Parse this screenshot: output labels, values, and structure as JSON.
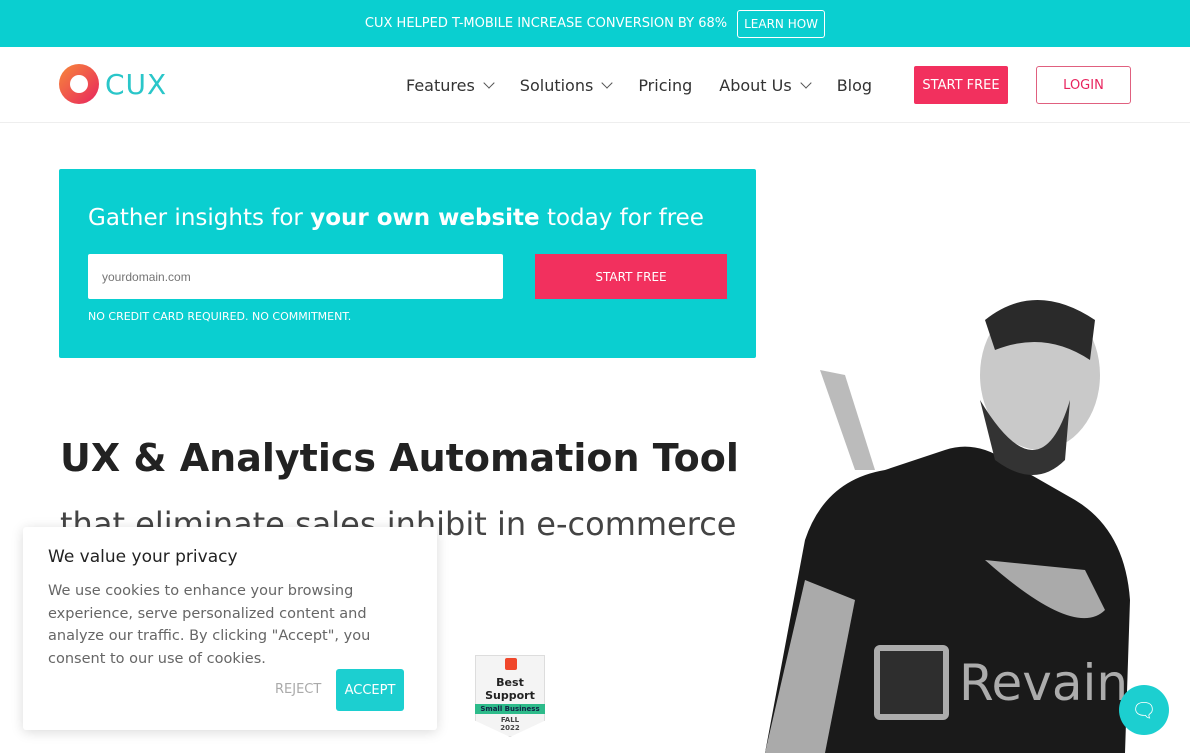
{
  "announcement": {
    "text": "CUX HELPED T-MOBILE INCREASE CONVERSION BY 68%",
    "button": "LEARN HOW"
  },
  "nav": {
    "logo": "CUX",
    "items": [
      {
        "label": "Features",
        "dropdown": true
      },
      {
        "label": "Solutions",
        "dropdown": true
      },
      {
        "label": "Pricing"
      },
      {
        "label": "About Us",
        "dropdown": true
      },
      {
        "label": "Blog"
      }
    ],
    "start_free": "START FREE",
    "login": "LOGIN"
  },
  "hero": {
    "title_pre": "Gather insights for ",
    "title_bold": "your own website",
    "title_post": " today for free",
    "input_placeholder": "yourdomain.com",
    "button": "START FREE",
    "note": "NO CREDIT CARD REQUIRED. NO COMMITMENT."
  },
  "headline": "UX & Analytics Automation Tool",
  "subheadline": "that eliminate sales inhibit in e-commerce",
  "badge": {
    "title": "Best Support",
    "ribbon": "Small Business",
    "season": "FALL",
    "year": "2022"
  },
  "cookie": {
    "title": "We value your privacy",
    "body": "We use cookies to enhance your browsing experience, serve personalized content and analyze our traffic. By clicking \"Accept\", you consent to our use of cookies.",
    "reject": "REJECT",
    "accept": "ACCEPT"
  },
  "watermark": "Revain",
  "colors": {
    "brand_teal": "#0acfd0",
    "brand_pink": "#f2305e"
  }
}
